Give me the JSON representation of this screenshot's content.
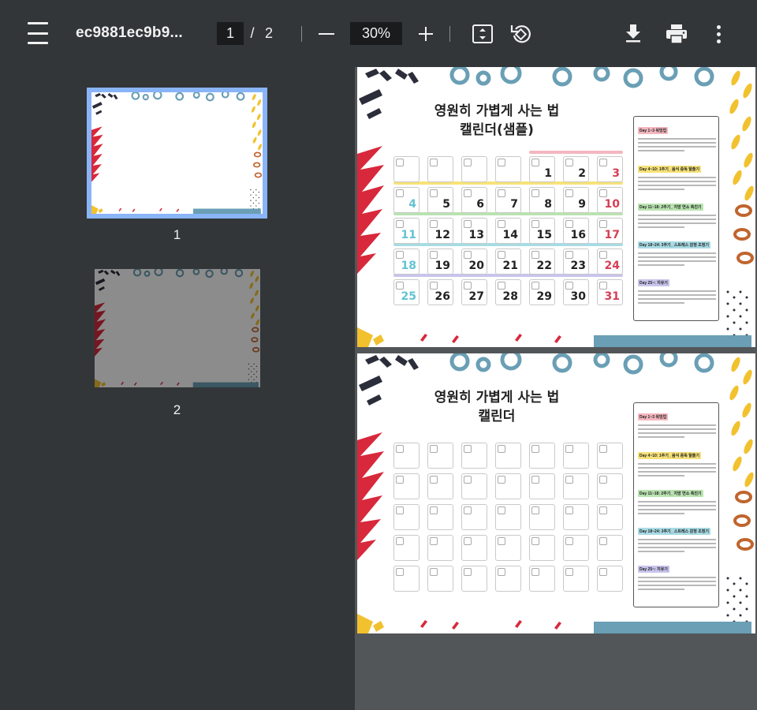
{
  "toolbar": {
    "filename": "ec9881ec9b9...",
    "current_page": "1",
    "separator": "/",
    "total_pages": "2",
    "zoom": "30%"
  },
  "icons": {
    "menu": "menu-icon",
    "zoom_out": "minus-icon",
    "zoom_in": "plus-icon",
    "fit": "fit-to-page-icon",
    "rotate": "rotate-icon",
    "download": "download-icon",
    "print": "print-icon",
    "more": "more-vertical-icon"
  },
  "thumbnails": [
    {
      "label": "1",
      "selected": true
    },
    {
      "label": "2",
      "selected": false
    }
  ],
  "pages": [
    {
      "title_line1": "영원히 가볍게 사는 법",
      "title_line2": "캘린더(샘플)",
      "days": [
        "",
        "",
        "",
        "",
        "1",
        "2",
        "3",
        "4",
        "5",
        "6",
        "7",
        "8",
        "9",
        "10",
        "11",
        "12",
        "13",
        "14",
        "15",
        "16",
        "17",
        "18",
        "19",
        "20",
        "21",
        "22",
        "23",
        "24",
        "25",
        "26",
        "27",
        "28",
        "29",
        "30",
        "31"
      ]
    },
    {
      "title_line1": "영원히 가볍게 사는 법",
      "title_line2": "캘린더",
      "days": []
    }
  ],
  "stages": [
    {
      "label": "Day 1~3 워밍업",
      "color": "#f4b7bf"
    },
    {
      "label": "Day 4~10: 1주기_ 음식 중독 탈출기",
      "color": "#f6e27a"
    },
    {
      "label": "Day 11~18: 2주기_ 지방 연소 촉진기",
      "color": "#b9e3b0"
    },
    {
      "label": "Day 18~24: 3주기_ 스트레스 감정 조정기",
      "color": "#a8dbe4"
    },
    {
      "label": "Day 25~: 지유기",
      "color": "#c8c4ec"
    }
  ],
  "colors": {
    "toolbar_bg": "#323639",
    "viewer_bg": "#525659",
    "selected_border": "#8ab4f8",
    "sunday_red": "#d43f55",
    "blue_number": "#62c3d2"
  }
}
